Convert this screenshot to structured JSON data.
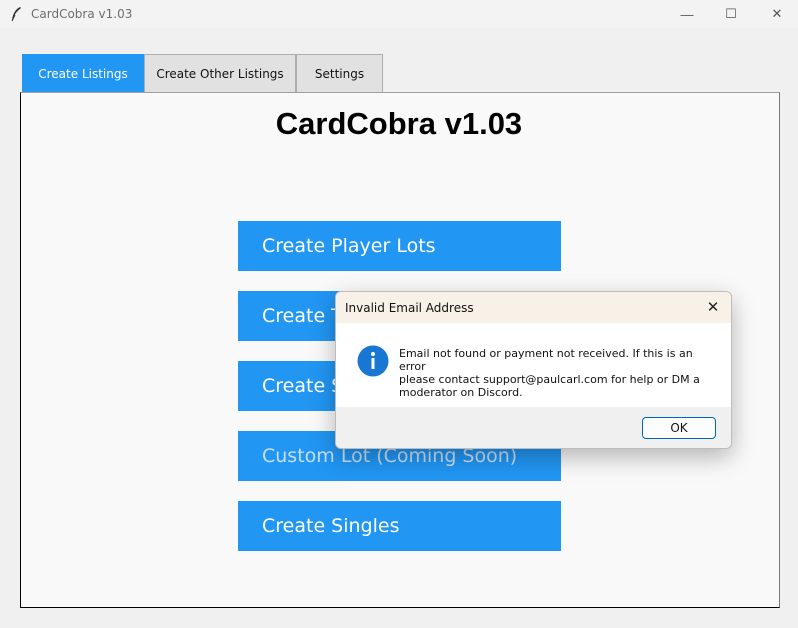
{
  "window": {
    "title": "CardCobra v1.03",
    "minimize_glyph": "—",
    "maximize_glyph": "☐",
    "close_glyph": "✕",
    "app_icon": "feather-icon"
  },
  "tabs": [
    {
      "label": "Create Listings",
      "active": true
    },
    {
      "label": "Create Other Listings",
      "active": false
    },
    {
      "label": "Settings",
      "active": false
    }
  ],
  "main": {
    "heading": "CardCobra v1.03",
    "buttons": [
      {
        "label": "Create Player Lots"
      },
      {
        "label": "Create Team Lots"
      },
      {
        "label": "Create Set Lots"
      },
      {
        "label": "Custom Lot (Coming Soon)"
      },
      {
        "label": "Create Singles"
      }
    ]
  },
  "dialog": {
    "title": "Invalid Email Address",
    "close_glyph": "✕",
    "icon": "info-icon",
    "message_lines": [
      "Email not found or payment not received. If this is an error",
      "please contact support@paulcarl.com for help or DM a",
      "moderator on Discord."
    ],
    "ok_label": "OK"
  },
  "colors": {
    "accent": "#2196f3",
    "panel_bg": "#f9f9f9",
    "dialog_title_bg": "#f7f1e8",
    "info_icon": "#1976d2"
  }
}
